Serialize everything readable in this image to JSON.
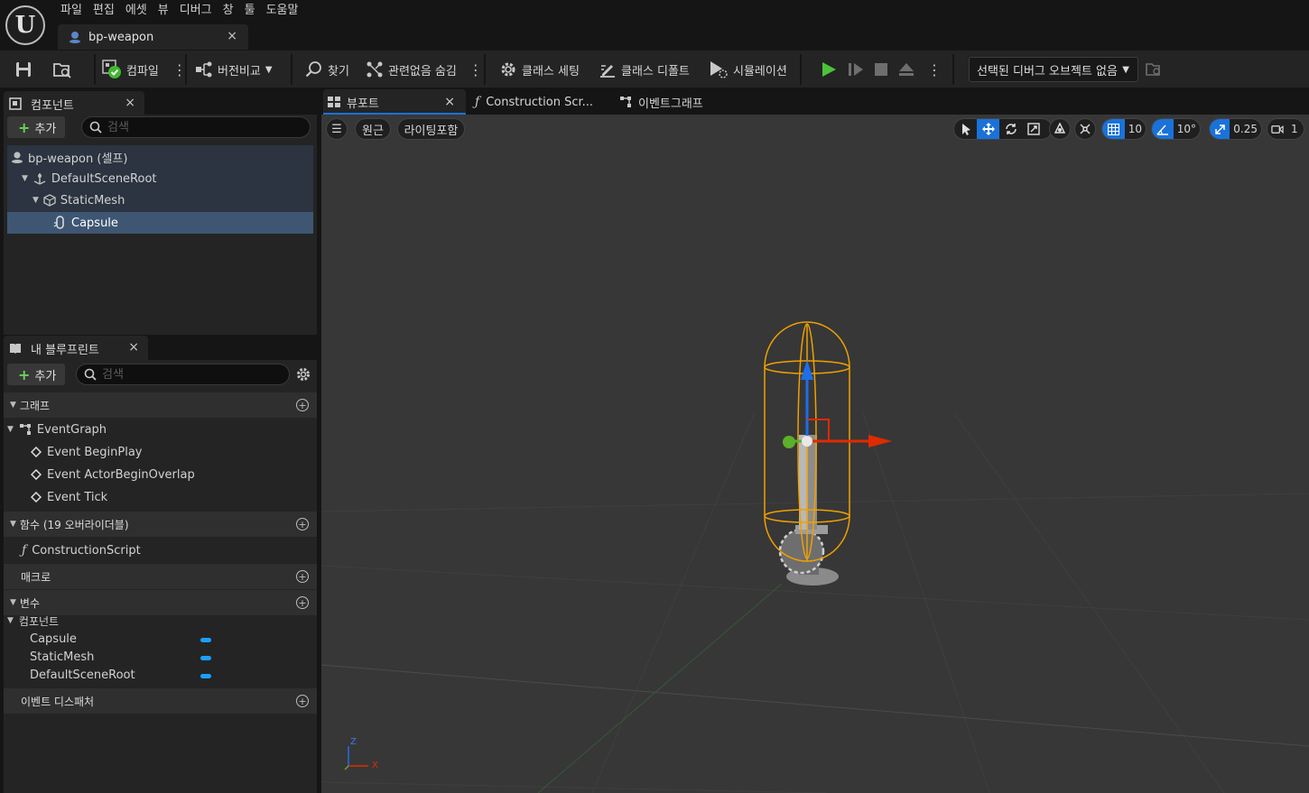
{
  "menu": [
    "파일",
    "편집",
    "에셋",
    "뷰",
    "디버그",
    "창",
    "툴",
    "도움말"
  ],
  "document_tab": {
    "label": "bp-weapon",
    "close": "×"
  },
  "toolbar": {
    "compile": "컴파일",
    "diff": "버전비교",
    "find": "찾기",
    "hide_unrelated": "관련없음 숨김",
    "class_settings": "클래스 세팅",
    "class_defaults": "클래스 디폴트",
    "simulation": "시뮬레이션",
    "debug_object": "선택된 디버그 오브젝트 없음"
  },
  "components_panel": {
    "tab": "컴포넌트",
    "close": "×",
    "add_label": "추가",
    "search_placeholder": "검색",
    "tree": [
      {
        "label": "bp-weapon (셀프)"
      },
      {
        "label": "DefaultSceneRoot"
      },
      {
        "label": "StaticMesh"
      },
      {
        "label": "Capsule"
      }
    ]
  },
  "blueprint_panel": {
    "tab": "내 블루프린트",
    "close": "×",
    "add_label": "추가",
    "search_placeholder": "검색",
    "graphs_section": "그래프",
    "event_graph": "EventGraph",
    "events": [
      "Event BeginPlay",
      "Event ActorBeginOverlap",
      "Event Tick"
    ],
    "functions_section": "함수 (19 오버라이더블)",
    "construction_script": "ConstructionScript",
    "macros_section": "매크로",
    "variables_section": "변수",
    "components_category": "컴포넌트",
    "variables": [
      "Capsule",
      "StaticMesh",
      "DefaultSceneRoot"
    ],
    "dispatchers_section": "이벤트 디스패처",
    "variable_color": "#1aa0ff"
  },
  "viewport_tabs": [
    {
      "label": "뷰포트",
      "close": "×"
    },
    {
      "label": "Construction Scr..."
    },
    {
      "label": "이벤트그래프"
    }
  ],
  "viewport": {
    "perspective": "원근",
    "lighting": "라이팅포함",
    "grid_snap": "10",
    "rotation_snap": "10°",
    "scale_snap": "0.25",
    "camera_speed": "1",
    "axis_x": "X",
    "axis_z": "Z"
  },
  "colors": {
    "accent_blue": "#1a72d8",
    "selection": "#3f5673",
    "play_green": "#4cc33a",
    "capsule_orange": "#f0a000"
  }
}
